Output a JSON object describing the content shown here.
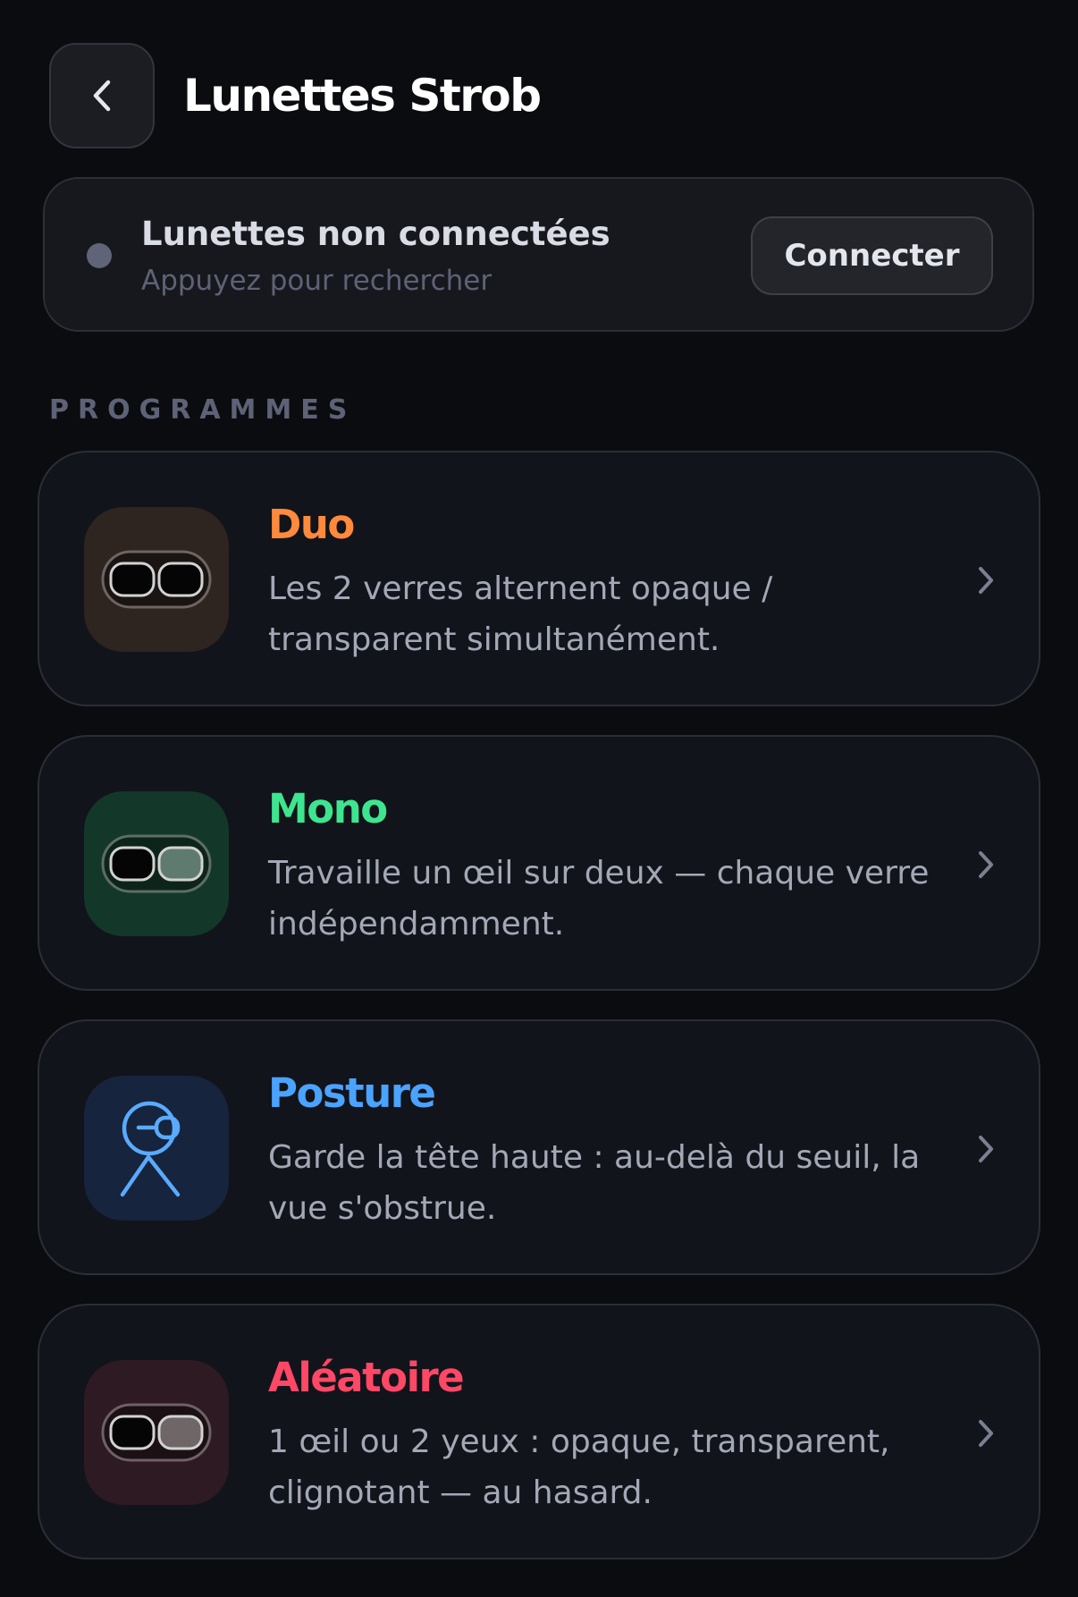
{
  "header": {
    "title": "Lunettes Strob"
  },
  "connection": {
    "title": "Lunettes non connectées",
    "subtitle": "Appuyez pour rechercher",
    "button_label": "Connecter"
  },
  "section_label": "PROGRAMMES",
  "programs": [
    {
      "name": "Duo",
      "description": "Les 2 verres alternent opaque / transparent simultanément.",
      "accent": "#ff8a3d",
      "icon_bg": "#2e2420",
      "icon": "glasses-both-opaque-icon"
    },
    {
      "name": "Mono",
      "description": "Travaille un œil sur deux — chaque verre indépendamment.",
      "accent": "#3ee58f",
      "icon_bg": "#133829",
      "icon": "glasses-one-eye-icon"
    },
    {
      "name": "Posture",
      "description": "Garde la tête haute : au-delà du seuil, la vue s'obstrue.",
      "accent": "#4aa3ff",
      "icon_bg": "#16243d",
      "icon": "person-head-up-icon"
    },
    {
      "name": "Aléatoire",
      "description": "1 œil ou 2 yeux : opaque, transparent, clignotant — au hasard.",
      "accent": "#ff4766",
      "icon_bg": "#2e1a22",
      "icon": "glasses-random-icon"
    }
  ]
}
